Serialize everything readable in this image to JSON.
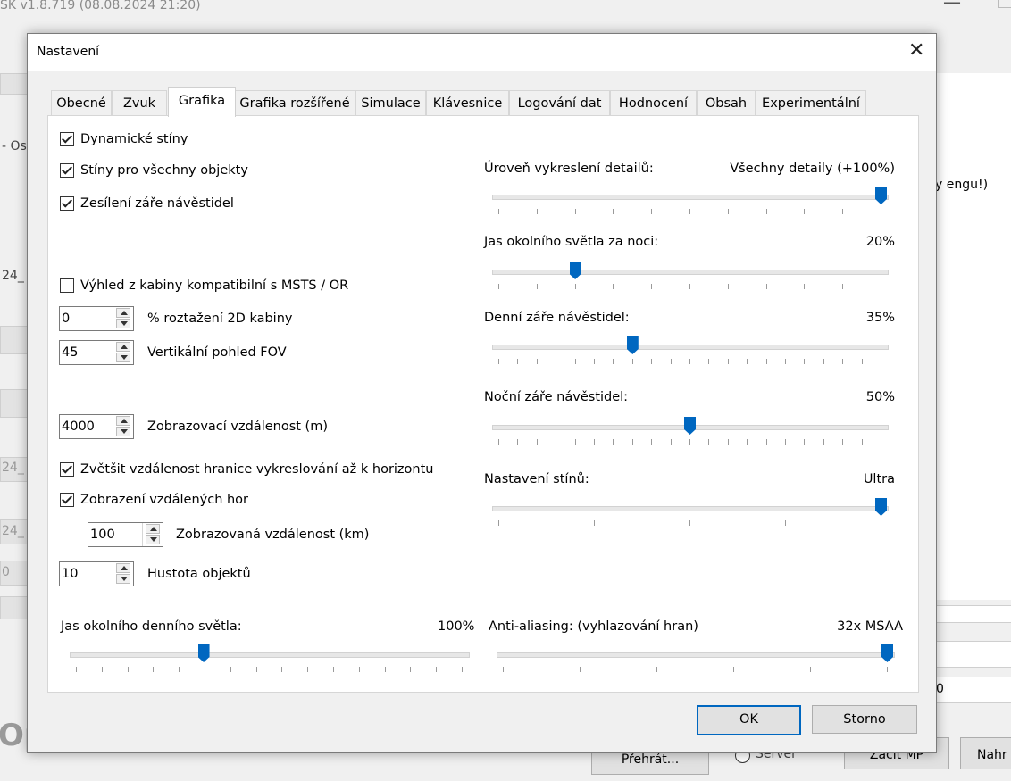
{
  "background": {
    "app_title": "SK v1.8.719 (08.08.2024 21:20)",
    "side_fragments": [
      "- Os",
      "24_",
      "24_",
      "24_",
      "0"
    ],
    "right_fragment": "y engu!)",
    "big_text": "Op",
    "play_button": "Přehrát...",
    "server_radio": "Server",
    "start_mp_button": "Začít MP",
    "load_button": "Nahr",
    "zero_field": "0"
  },
  "dialog": {
    "title": "Nastavení",
    "tabs": [
      "Obecné",
      "Zvuk",
      "Grafika",
      "Grafika rozšířené",
      "Simulace",
      "Klávesnice",
      "Logování dat",
      "Hodnocení",
      "Obsah",
      "Experimentální"
    ],
    "active_tab": "Grafika",
    "checkboxes": {
      "dynamic_shadows": {
        "label": "Dynamické stíny",
        "checked": true
      },
      "shadows_all": {
        "label": "Stíny pro všechny objekty",
        "checked": true
      },
      "signal_glow": {
        "label": "Zesílení záře návěstidel",
        "checked": true
      },
      "cab_view": {
        "label": "Výhled z kabiny kompatibilní s MSTS / OR",
        "checked": false
      },
      "extend_horizon": {
        "label": "Zvětšit vzdálenost hranice vykreslování až k horizontu",
        "checked": true
      },
      "distant_mountains": {
        "label": "Zobrazení vzdálených hor",
        "checked": true
      }
    },
    "spinners": {
      "cab_stretch": {
        "value": "0",
        "label": "% roztažení 2D kabiny"
      },
      "fov": {
        "value": "45",
        "label": "Vertikální pohled FOV"
      },
      "view_distance": {
        "value": "4000",
        "label": "Zobrazovací vzdálenost (m)"
      },
      "mountain_distance": {
        "value": "100",
        "label": "Zobrazovaná vzdálenost (km)"
      },
      "object_density": {
        "value": "10",
        "label": "Hustota objektů"
      }
    },
    "sliders": {
      "detail_level": {
        "label": "Úroveň vykreslení detailů:",
        "value": "Všechny detaily (+100%)",
        "fraction": 1.0
      },
      "night_ambient": {
        "label": "Jas okolního světla za noci:",
        "value": "20%",
        "fraction": 0.2
      },
      "day_signal_glow": {
        "label": "Denní záře návěstidel:",
        "value": "35%",
        "fraction": 0.35
      },
      "night_signal_glow": {
        "label": "Noční záře návěstidel:",
        "value": "50%",
        "fraction": 0.5
      },
      "shadow_setting": {
        "label": "Nastavení stínů:",
        "value": "Ultra",
        "fraction": 1.0
      },
      "day_ambient": {
        "label": "Jas okolního denního světla:",
        "value": "100%",
        "fraction": 0.33
      },
      "antialiasing": {
        "label": "Anti-aliasing: (vyhlazování hran)",
        "value": "32x MSAA",
        "fraction": 1.0
      }
    },
    "ok_button": "OK",
    "cancel_button": "Storno"
  }
}
